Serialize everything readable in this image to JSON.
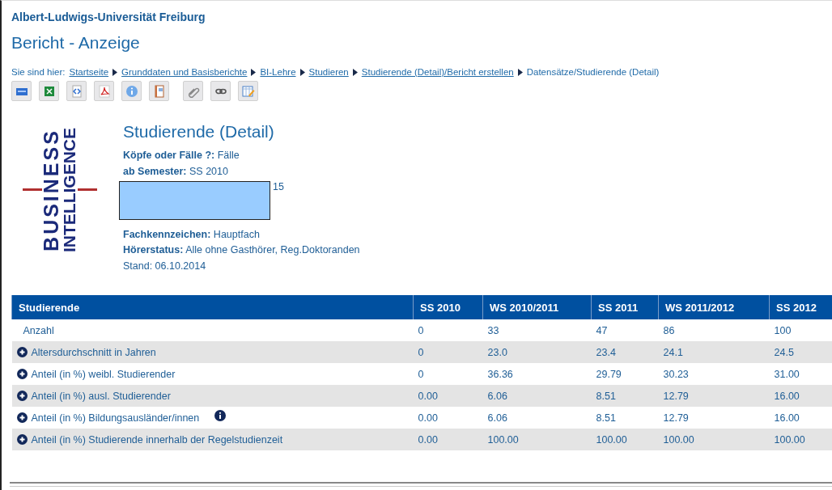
{
  "university": "Albert-Ludwigs-Universität Freiburg",
  "page_title": "Bericht - Anzeige",
  "breadcrumb": {
    "prefix": "Sie sind hier:",
    "links": [
      "Startseite",
      "Grunddaten und Basisberichte",
      "BI-Lehre",
      "Studieren",
      "Studierende (Detail)/Bericht erstellen"
    ],
    "current": "Datensätze/Studierende (Detail)"
  },
  "toolbar": [
    {
      "kind": "html"
    },
    {
      "kind": "excel"
    },
    {
      "kind": "xml"
    },
    {
      "kind": "pdf"
    },
    {
      "kind": "info"
    },
    {
      "kind": "report"
    },
    {
      "kind": "clip"
    },
    {
      "kind": "link"
    },
    {
      "kind": "edit"
    }
  ],
  "logo": {
    "lines": [
      "BUSINESS",
      "INTELLIGENCE"
    ]
  },
  "report": {
    "title": "Studierende (Detail)",
    "details": [
      {
        "kind": "field",
        "label": "Köpfe oder Fälle ?:",
        "value": "Fälle"
      },
      {
        "kind": "field",
        "label": "ab Semester:",
        "value": "SS 2010"
      },
      {
        "kind": "partial",
        "value": "15"
      },
      {
        "kind": "field",
        "label": "Fachkennzeichen:",
        "value": "Hauptfach"
      },
      {
        "kind": "field",
        "label": "Hörerstatus:",
        "value": "Alle ohne Gasthörer, Reg.Doktoranden"
      },
      {
        "kind": "plain",
        "value": "Stand: 06.10.2014"
      }
    ]
  },
  "table": {
    "columns": [
      "Studierende",
      "SS 2010",
      "WS 2010/2011",
      "SS 2011",
      "WS 2011/2012",
      "SS 2012"
    ],
    "rows": [
      {
        "expandable": false,
        "info": false,
        "cells": [
          "Anzahl",
          "0",
          "33",
          "47",
          "86",
          "100"
        ]
      },
      {
        "expandable": true,
        "info": false,
        "cells": [
          "Altersdurchschnitt in Jahren",
          "0",
          "23.0",
          "23.4",
          "24.1",
          "24.5"
        ]
      },
      {
        "expandable": true,
        "info": false,
        "cells": [
          "Anteil (in %) weibl. Studierender",
          "0",
          "36.36",
          "29.79",
          "30.23",
          "31.00"
        ]
      },
      {
        "expandable": true,
        "info": false,
        "cells": [
          "Anteil (in %) ausl. Studierender",
          "0.00",
          "6.06",
          "8.51",
          "12.79",
          "16.00"
        ]
      },
      {
        "expandable": true,
        "info": true,
        "cells": [
          "Anteil (in %) Bildungsausländer/innen",
          "0.00",
          "6.06",
          "8.51",
          "12.79",
          "16.00"
        ]
      },
      {
        "expandable": true,
        "info": false,
        "cells": [
          "Anteil (in %) Studierende innerhalb der Regelstudienzeit",
          "0.00",
          "100.00",
          "100.00",
          "100.00",
          "100.00"
        ]
      }
    ]
  }
}
